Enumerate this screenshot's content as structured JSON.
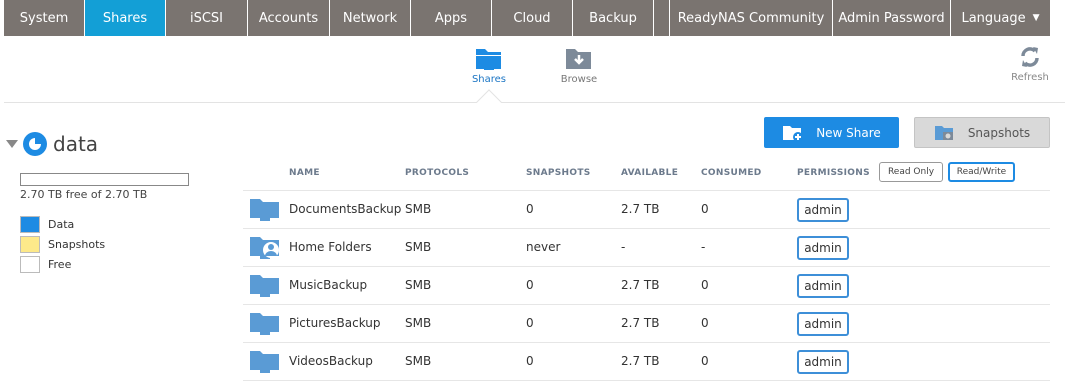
{
  "nav": {
    "items": [
      {
        "label": "System"
      },
      {
        "label": "Shares",
        "active": true
      },
      {
        "label": "iSCSI"
      },
      {
        "label": "Accounts"
      },
      {
        "label": "Network"
      },
      {
        "label": "Apps"
      },
      {
        "label": "Cloud"
      },
      {
        "label": "Backup"
      },
      {
        "label": ""
      },
      {
        "label": "ReadyNAS Community"
      },
      {
        "label": "Admin Password"
      },
      {
        "label": "Language"
      }
    ]
  },
  "subnav": {
    "shares_label": "Shares",
    "browse_label": "Browse",
    "refresh_label": "Refresh"
  },
  "volume": {
    "name": "data",
    "free_text": "2.70 TB free of 2.70 TB",
    "legend": [
      {
        "label": "Data",
        "color": "#1d8be3"
      },
      {
        "label": "Snapshots",
        "color": "#fde98a"
      },
      {
        "label": "Free",
        "color": "#ffffff"
      }
    ]
  },
  "actions": {
    "new_share": "New Share",
    "snapshots": "Snapshots"
  },
  "table": {
    "headers": {
      "name": "NAME",
      "protocols": "PROTOCOLS",
      "snapshots": "SNAPSHOTS",
      "available": "AVAILABLE",
      "consumed": "CONSUMED",
      "permissions": "PERMISSIONS"
    },
    "perm_read_only": "Read Only",
    "perm_read_write": "Read/Write",
    "rows": [
      {
        "name": "DocumentsBackup",
        "protocols": "SMB",
        "snapshots": "0",
        "available": "2.7 TB",
        "consumed": "0",
        "permission": "admin",
        "icon": "folder-icon"
      },
      {
        "name": "Home Folders",
        "protocols": "SMB",
        "snapshots": "never",
        "available": "-",
        "consumed": "-",
        "permission": "admin",
        "icon": "home-folder-icon"
      },
      {
        "name": "MusicBackup",
        "protocols": "SMB",
        "snapshots": "0",
        "available": "2.7 TB",
        "consumed": "0",
        "permission": "admin",
        "icon": "folder-icon"
      },
      {
        "name": "PicturesBackup",
        "protocols": "SMB",
        "snapshots": "0",
        "available": "2.7 TB",
        "consumed": "0",
        "permission": "admin",
        "icon": "folder-icon"
      },
      {
        "name": "VideosBackup",
        "protocols": "SMB",
        "snapshots": "0",
        "available": "2.7 TB",
        "consumed": "0",
        "permission": "admin",
        "icon": "folder-icon"
      }
    ]
  },
  "colors": {
    "nav_bg": "#7a7470",
    "nav_active": "#139fd6",
    "accent": "#1d8be3"
  }
}
